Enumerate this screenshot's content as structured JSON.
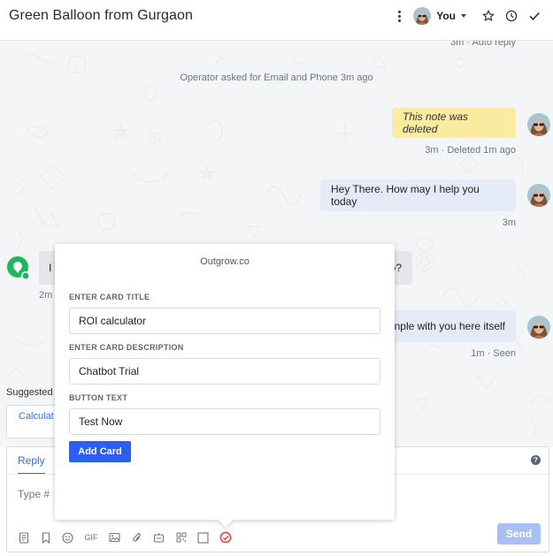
{
  "header": {
    "title": "Green Balloon from Gurgaon",
    "assignee": "You"
  },
  "messages": {
    "top_meta": "3m · Auto reply",
    "operator_note": "Operator asked for Email and Phone 3m ago",
    "deleted_note": "This note was deleted",
    "deleted_meta": "3m · Deleted 1m ago",
    "agent_greeting": "Hey There. How may I help you today",
    "agent_greeting_meta": "3m",
    "visitor_partial_start": "I",
    "visitor_partial_end": "o?",
    "visitor_meta_partial": "2m",
    "agent_reply_partial": "nple with you here itself",
    "agent_reply_meta": "1m · Seen"
  },
  "suggested": {
    "label": "Suggested",
    "chip": "Calculat"
  },
  "composer": {
    "tab_reply": "Reply",
    "placeholder": "Type # t",
    "send_label": "Send",
    "gif_label": "GIF"
  },
  "popup": {
    "title": "Outgrow.co",
    "card_title_label": "ENTER CARD TITLE",
    "card_title_value": "ROI calculator",
    "card_desc_label": "ENTER CARD DESCRIPTION",
    "card_desc_value": "Chatbot Trial",
    "button_text_label": "BUTTON TEXT",
    "button_text_value": "Test Now",
    "add_card_label": "Add Card"
  },
  "colors": {
    "accent": "#2c5ff0",
    "deleted_bubble": "#fbeba1",
    "agent_bubble": "#e4ebf7",
    "visitor_bubble": "#e4e6e9",
    "balloon_green": "#1cb85c",
    "outgrow_red": "#e8453c"
  }
}
